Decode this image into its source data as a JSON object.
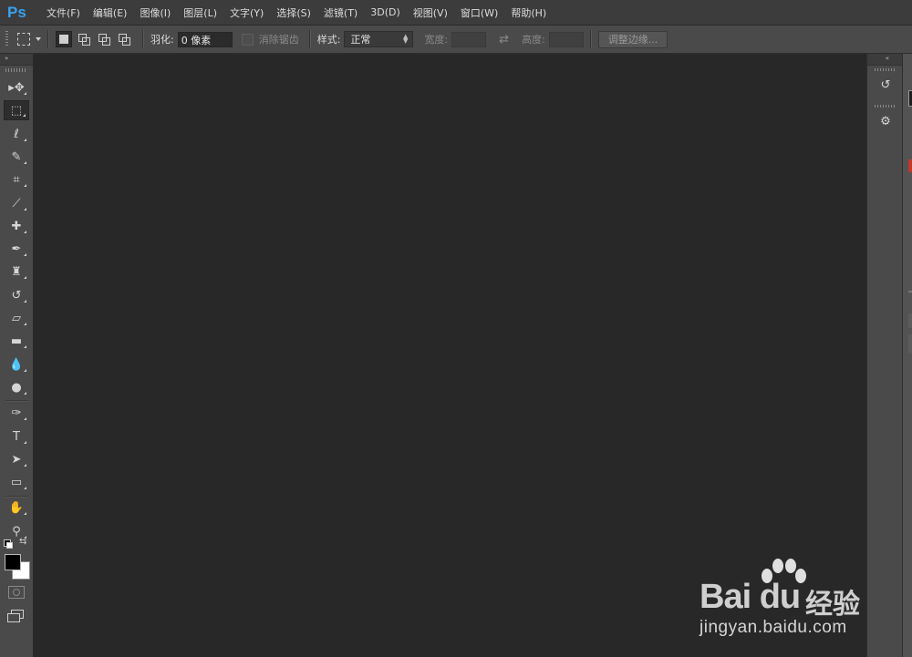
{
  "app": {
    "logo_text": "Ps"
  },
  "menu": [
    {
      "label": "文件(F)"
    },
    {
      "label": "编辑(E)"
    },
    {
      "label": "图像(I)"
    },
    {
      "label": "图层(L)"
    },
    {
      "label": "文字(Y)"
    },
    {
      "label": "选择(S)"
    },
    {
      "label": "滤镜(T)"
    },
    {
      "label": "3D(D)"
    },
    {
      "label": "视图(V)"
    },
    {
      "label": "窗口(W)"
    },
    {
      "label": "帮助(H)"
    }
  ],
  "options": {
    "feather_label": "羽化:",
    "feather_value": "0 像素",
    "antialias_label": "消除锯齿",
    "style_label": "样式:",
    "style_value": "正常",
    "width_label": "宽度:",
    "height_label": "高度:",
    "refine_edge_label": "调整边缘..."
  },
  "toolbar": {
    "collapse_glyph": "»",
    "tools": [
      {
        "name": "move-tool",
        "glyph": "▸✥"
      },
      {
        "name": "rect-marquee-tool",
        "glyph": "⬚",
        "active": true
      },
      {
        "name": "lasso-tool",
        "glyph": "ℓ"
      },
      {
        "name": "quick-select-tool",
        "glyph": "✎"
      },
      {
        "name": "crop-tool",
        "glyph": "⌗"
      },
      {
        "name": "eyedropper-tool",
        "glyph": "⟋"
      },
      {
        "name": "healing-brush-tool",
        "glyph": "✚"
      },
      {
        "name": "brush-tool",
        "glyph": "✒"
      },
      {
        "name": "clone-stamp-tool",
        "glyph": "♜"
      },
      {
        "name": "history-brush-tool",
        "glyph": "↺"
      },
      {
        "name": "eraser-tool",
        "glyph": "▱"
      },
      {
        "name": "gradient-tool",
        "glyph": "▬"
      },
      {
        "name": "blur-tool",
        "glyph": "💧"
      },
      {
        "name": "dodge-tool",
        "glyph": "●"
      },
      {
        "name": "pen-tool",
        "glyph": "✑"
      },
      {
        "name": "type-tool",
        "glyph": "T"
      },
      {
        "name": "path-select-tool",
        "glyph": "➤"
      },
      {
        "name": "rectangle-shape-tool",
        "glyph": "▭"
      },
      {
        "name": "hand-tool",
        "glyph": "✋"
      },
      {
        "name": "zoom-tool",
        "glyph": "⚲"
      }
    ],
    "foreground_color": "#000000",
    "background_color": "#ffffff"
  },
  "dock": {
    "collapse_glyph": "«",
    "icons": [
      {
        "name": "history-panel-icon",
        "glyph": "↺"
      },
      {
        "name": "properties-panel-icon",
        "glyph": "⚙"
      }
    ]
  },
  "watermark": {
    "logo": "Bai du",
    "product": "经验",
    "url": "jingyan.baidu.com"
  }
}
